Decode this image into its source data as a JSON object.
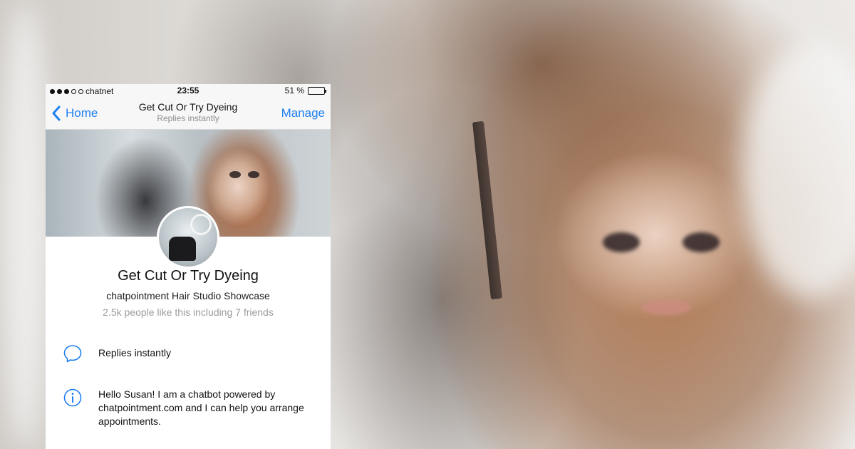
{
  "status_bar": {
    "carrier": "chatnet",
    "time": "23:55",
    "battery": "51 %",
    "battery_level": 0.51
  },
  "nav": {
    "back_label": "Home",
    "title": "Get Cut Or Try Dyeing",
    "subtitle": "Replies instantly",
    "right_label": "Manage"
  },
  "profile": {
    "name": "Get Cut Or Try Dyeing",
    "category": "chatpointment Hair Studio Showcase",
    "likes": "2.5k people like this including 7 friends"
  },
  "info_rows": [
    {
      "icon": "chat-bubble-icon",
      "text": "Replies instantly"
    },
    {
      "icon": "info-icon",
      "text": "Hello Susan! I am a chatbot powered by chatpointment.com and I can help you arrange appointments."
    }
  ],
  "colors": {
    "accent": "#1f7ff2",
    "muted_text": "#9b9b9b"
  }
}
